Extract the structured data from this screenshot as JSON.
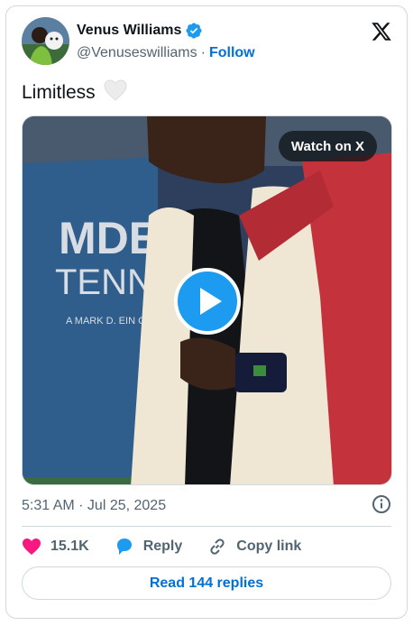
{
  "author": {
    "name": "Venus Williams",
    "handle": "@Venuseswilliams",
    "separator": "·",
    "follow_label": "Follow",
    "verified_icon": "verified-badge-icon",
    "verified_color": "#1d9bf0"
  },
  "tweet": {
    "text": "Limitless",
    "emoji": "🤍"
  },
  "media": {
    "watch_label": "Watch on X",
    "banner_line1": "MDE",
    "banner_line2": "TENN",
    "banner_line3": "A MARK D. EIN C"
  },
  "meta": {
    "timestamp": "5:31 AM · Jul 25, 2025"
  },
  "actions": {
    "like_count": "15.1K",
    "reply_label": "Reply",
    "copy_label": "Copy link",
    "like_color": "#f91880",
    "reply_color": "#1d9bf0"
  },
  "footer": {
    "read_replies_label": "Read 144 replies"
  },
  "brand": {
    "accent": "#006fd6",
    "text_secondary": "#536471",
    "border": "#cfd9de"
  }
}
